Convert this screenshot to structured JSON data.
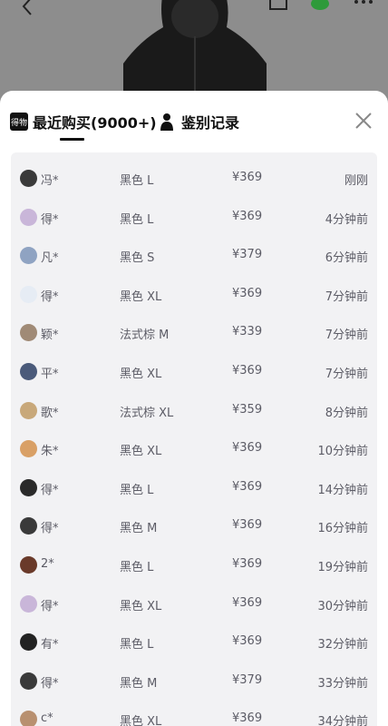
{
  "colors": {
    "sheet_bg": "#ffffff",
    "panel_bg": "#f2f2f4",
    "text_primary": "#111111",
    "text_row": "#5c5c66"
  },
  "icons": {
    "back": "back-arrow-icon",
    "close": "close-icon",
    "auth": "person-silhouette-icon"
  },
  "tabs": {
    "recent_logo": "得物",
    "recent_label": "最近购买(9000+)",
    "auth_label": "鉴别记录"
  },
  "purchases": [
    {
      "user": "冯*",
      "variant": "黑色 L",
      "price": "¥369",
      "time": "刚刚"
    },
    {
      "user": "得*",
      "variant": "黑色 L",
      "price": "¥369",
      "time": "4分钟前"
    },
    {
      "user": "凡*",
      "variant": "黑色 S",
      "price": "¥379",
      "time": "6分钟前"
    },
    {
      "user": "得*",
      "variant": "黑色 XL",
      "price": "¥369",
      "time": "7分钟前"
    },
    {
      "user": "颖*",
      "variant": "法式棕 M",
      "price": "¥339",
      "time": "7分钟前"
    },
    {
      "user": "平*",
      "variant": "黑色 XL",
      "price": "¥369",
      "time": "7分钟前"
    },
    {
      "user": "歌*",
      "variant": "法式棕 XL",
      "price": "¥359",
      "time": "8分钟前"
    },
    {
      "user": "朱*",
      "variant": "黑色 XL",
      "price": "¥369",
      "time": "10分钟前"
    },
    {
      "user": "得*",
      "variant": "黑色 L",
      "price": "¥369",
      "time": "14分钟前"
    },
    {
      "user": "得*",
      "variant": "黑色 M",
      "price": "¥369",
      "time": "16分钟前"
    },
    {
      "user": "2*",
      "variant": "黑色 L",
      "price": "¥369",
      "time": "19分钟前"
    },
    {
      "user": "得*",
      "variant": "黑色 XL",
      "price": "¥369",
      "time": "30分钟前"
    },
    {
      "user": "有*",
      "variant": "黑色 L",
      "price": "¥369",
      "time": "32分钟前"
    },
    {
      "user": "得*",
      "variant": "黑色 M",
      "price": "¥379",
      "time": "33分钟前"
    },
    {
      "user": "c*",
      "variant": "黑色 XL",
      "price": "¥369",
      "time": "34分钟前"
    }
  ]
}
